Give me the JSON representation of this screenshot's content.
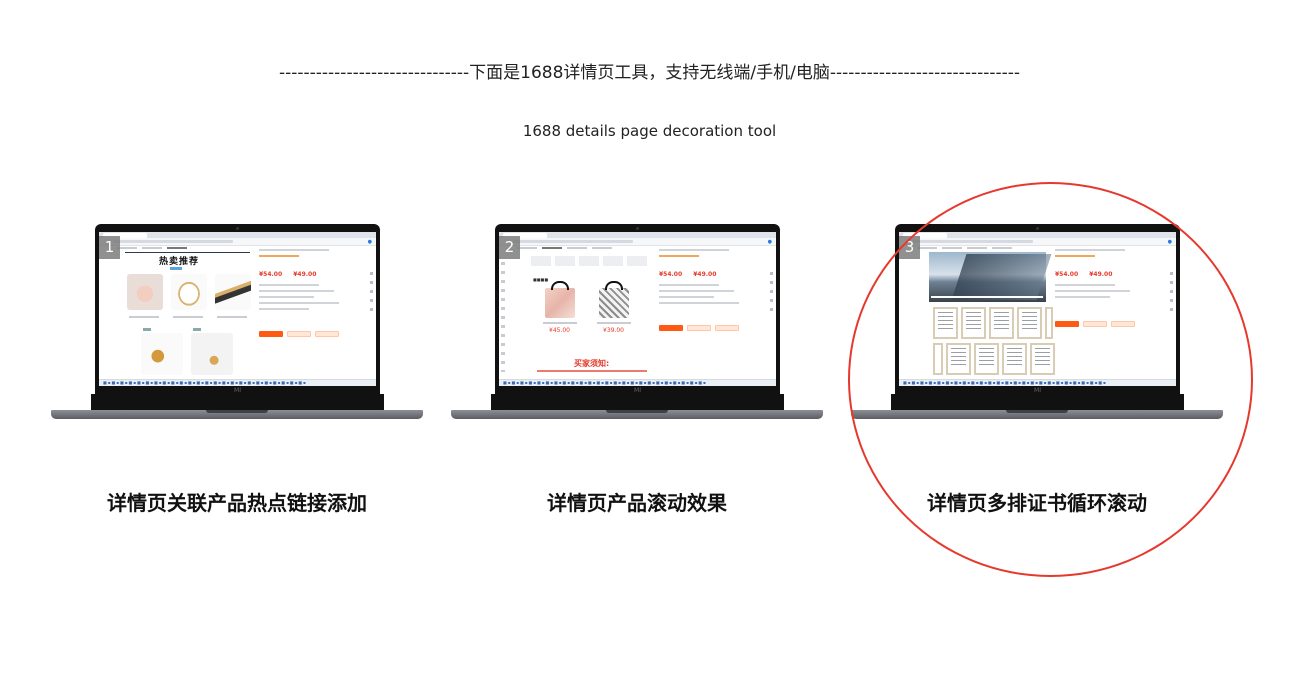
{
  "header": {
    "dashes_left": "-------------------------------",
    "title": "下面是1688详情页工具，支持无线端/手机/电脑",
    "dashes_right": "-------------------------------",
    "subtitle": "1688 details page decoration tool"
  },
  "cards": [
    {
      "number": "1",
      "caption": "详情页关联产品热点链接添加",
      "screen": {
        "section_title": "热卖推荐",
        "prices": [
          "¥54.00",
          "¥49.00"
        ],
        "brand_mark": "MI"
      }
    },
    {
      "number": "2",
      "caption": "详情页产品滚动效果",
      "screen": {
        "prices": [
          "¥54.00",
          "¥49.00"
        ],
        "product_prices": [
          "¥45.00",
          "¥39.00"
        ],
        "notice_title": "买家须知:",
        "brand_mark": "MI"
      }
    },
    {
      "number": "3",
      "caption": "详情页多排证书循环滚动",
      "screen": {
        "prices": [
          "¥54.00",
          "¥49.00"
        ],
        "brand_mark": "MI"
      }
    }
  ],
  "colors": {
    "accent_circle": "#e6392e",
    "price_red": "#e4392a",
    "button_orange": "#ff5a14"
  },
  "highlighted_card": 3
}
